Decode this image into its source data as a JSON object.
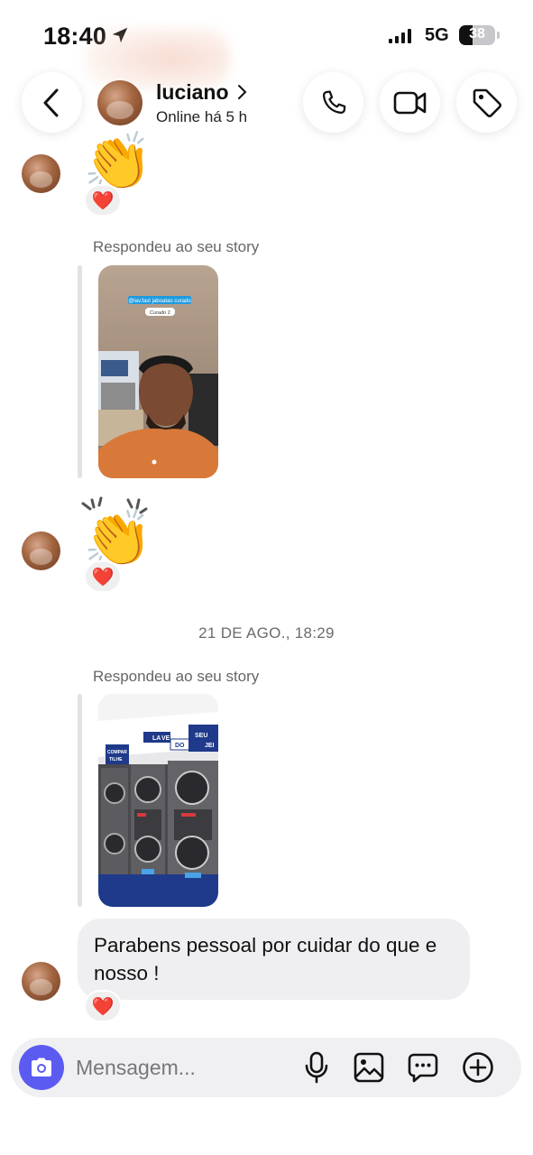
{
  "status_bar": {
    "time": "18:40",
    "network": "5G",
    "battery_level": "38",
    "battery_fraction": 0.38
  },
  "header": {
    "username": "luciano",
    "presence": "Online há 5 h",
    "icons": {
      "back": "chevron-left-icon",
      "call": "phone-icon",
      "video": "video-camera-icon",
      "label": "tag-icon"
    }
  },
  "messages": [
    {
      "type": "emoji",
      "emoji": "👏",
      "reaction": "❤️"
    },
    {
      "type": "story_reply",
      "label": "Respondeu ao seu story",
      "story_overlay_text": "@lav.fast jaboatao curado",
      "story_tag": "Curado 2"
    },
    {
      "type": "emoji",
      "emoji": "👏",
      "reaction": "❤️"
    },
    {
      "type": "date_separator",
      "text": "21 DE AGO., 18:29"
    },
    {
      "type": "story_reply",
      "label": "Respondeu ao seu story",
      "story_sign_words": [
        "LA",
        "VE",
        "DO",
        "SEU",
        "JEI",
        "COMPAR",
        "TILHE"
      ]
    },
    {
      "type": "text",
      "text": "Parabens pessoal por cuidar do que e nosso !",
      "reaction": "❤️"
    }
  ],
  "composer": {
    "placeholder": "Mensagem...",
    "value": "",
    "icons": {
      "camera": "camera-icon",
      "mic": "microphone-icon",
      "gallery": "image-icon",
      "sticker": "chat-bubble-icon",
      "add": "plus-circle-icon"
    },
    "accent_color": "#5b5bf2"
  }
}
